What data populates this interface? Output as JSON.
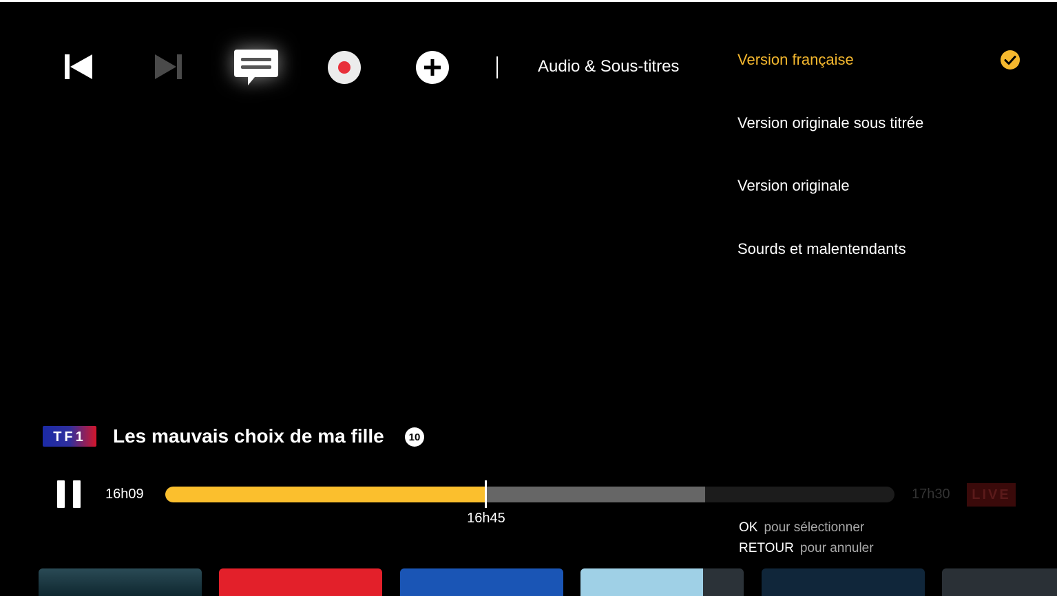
{
  "controls": {
    "prev_icon": "skip-previous-icon",
    "next_icon": "skip-next-icon",
    "subtitles_icon": "subtitles-icon",
    "record_icon": "record-icon",
    "add_icon": "add-icon",
    "section_label": "Audio & Sous-titres"
  },
  "options": {
    "items": [
      {
        "label": "Version française",
        "selected": true
      },
      {
        "label": "Version originale sous titrée",
        "selected": false
      },
      {
        "label": "Version originale",
        "selected": false
      },
      {
        "label": "Sourds et malentendants",
        "selected": false
      }
    ],
    "selected_icon": "check-circle-icon",
    "accent_color": "#f5b82e"
  },
  "program": {
    "channel": "TF1",
    "title": "Les mauvais choix de ma fille",
    "rating": "10"
  },
  "playback": {
    "state_icon": "pause-icon",
    "start_time": "16h09",
    "current_time": "16h45",
    "end_time": "17h30",
    "live_label": "LIVE",
    "played_fraction": 0.44,
    "buffered_fraction": 0.74,
    "progress_color": "#fbbf2d"
  },
  "hints": [
    {
      "key": "OK",
      "desc": "pour sélectionner"
    },
    {
      "key": "RETOUR",
      "desc": "pour annuler"
    }
  ]
}
